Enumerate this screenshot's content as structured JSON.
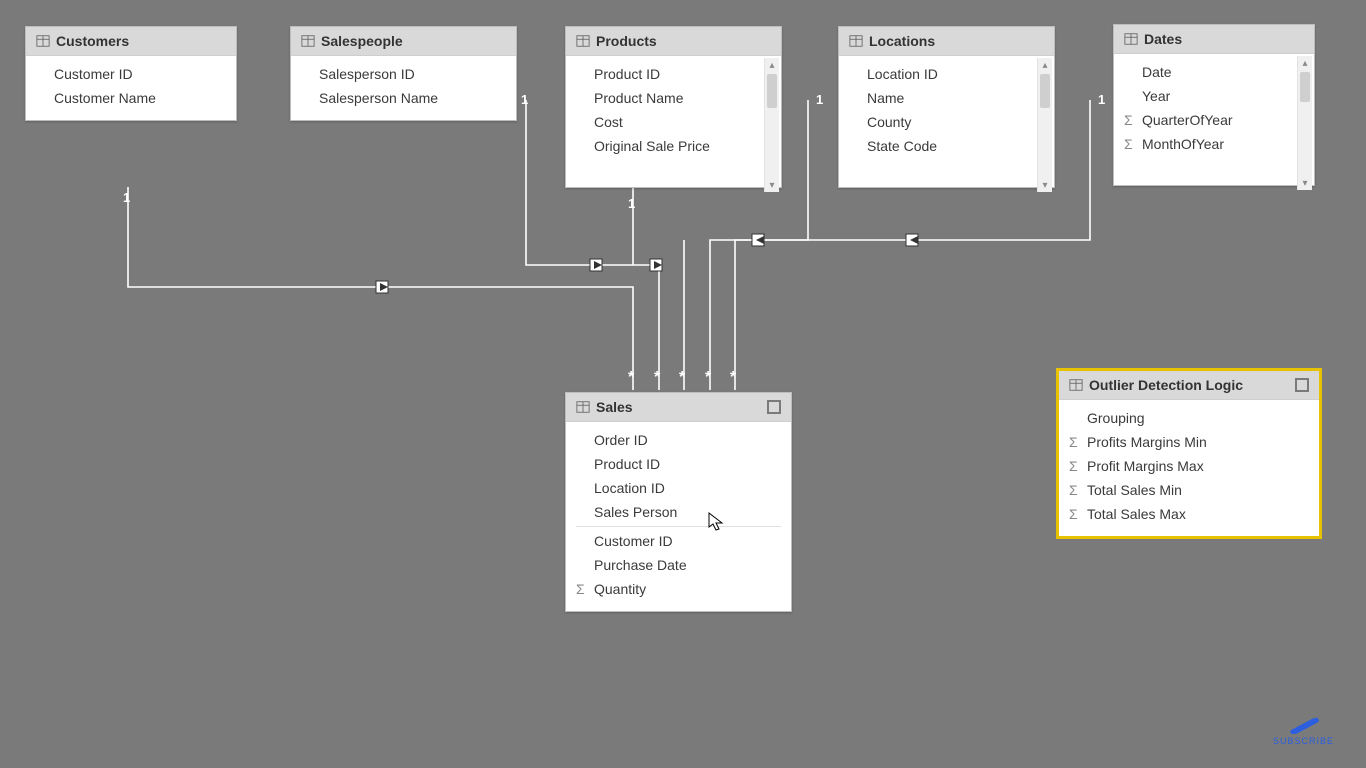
{
  "tables": {
    "customers": {
      "title": "Customers",
      "fields": [
        "Customer ID",
        "Customer Name"
      ]
    },
    "salespeople": {
      "title": "Salespeople",
      "fields": [
        "Salesperson ID",
        "Salesperson Name"
      ]
    },
    "products": {
      "title": "Products",
      "fields": [
        "Product ID",
        "Product Name",
        "Cost",
        "Original Sale Price"
      ]
    },
    "locations": {
      "title": "Locations",
      "fields": [
        "Location ID",
        "Name",
        "County",
        "State Code"
      ]
    },
    "dates": {
      "title": "Dates",
      "fields": [
        {
          "label": "Date"
        },
        {
          "label": "Year"
        },
        {
          "label": "QuarterOfYear",
          "sigma": true
        },
        {
          "label": "MonthOfYear",
          "sigma": true
        }
      ]
    },
    "sales": {
      "title": "Sales",
      "fields": [
        {
          "label": "Order ID"
        },
        {
          "label": "Product ID"
        },
        {
          "label": "Location ID"
        },
        {
          "label": "Sales Person"
        },
        {
          "label": "Customer ID",
          "sep": true
        },
        {
          "label": "Purchase Date"
        },
        {
          "label": "Quantity",
          "sigma": true
        }
      ]
    },
    "outlier": {
      "title": "Outlier Detection Logic",
      "fields": [
        {
          "label": "Grouping"
        },
        {
          "label": "Profits Margins Min",
          "sigma": true
        },
        {
          "label": "Profit Margins Max",
          "sigma": true
        },
        {
          "label": "Total Sales Min",
          "sigma": true
        },
        {
          "label": "Total Sales Max",
          "sigma": true
        }
      ]
    }
  },
  "cardinality": {
    "one": "1",
    "many": "*"
  },
  "logo": {
    "text": "SUBSCRIBE"
  }
}
